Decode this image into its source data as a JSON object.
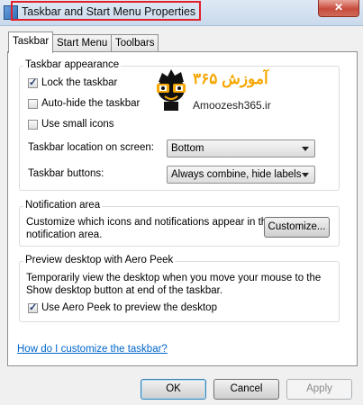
{
  "window": {
    "title": "Taskbar and Start Menu Properties",
    "close_glyph": "✕"
  },
  "tabs": [
    {
      "label": "Taskbar",
      "active": true
    },
    {
      "label": "Start Menu",
      "active": false
    },
    {
      "label": "Toolbars",
      "active": false
    }
  ],
  "appearance": {
    "legend": "Taskbar appearance",
    "lock": {
      "label": "Lock the taskbar",
      "checked": true
    },
    "autohide": {
      "label": "Auto-hide the taskbar",
      "checked": false
    },
    "small_icons": {
      "label": "Use small icons",
      "checked": false
    },
    "location_label": "Taskbar location on screen:",
    "location_value": "Bottom",
    "buttons_label": "Taskbar buttons:",
    "buttons_value": "Always combine, hide labels"
  },
  "watermark": {
    "brand_fa": "آموزش ۳۶۵",
    "url": "Amoozesh365.ir",
    "color": "#f6a600"
  },
  "notification": {
    "legend": "Notification area",
    "description_line1": "Customize which icons and notifications appear in the",
    "description_line2": "notification area.",
    "customize_label": "Customize..."
  },
  "aero_peek": {
    "legend": "Preview desktop with Aero Peek",
    "description_line1": "Temporarily view the desktop when you move your mouse to the",
    "description_line2": "Show desktop button at end of the taskbar.",
    "use_peek": {
      "label": "Use Aero Peek to preview the desktop",
      "checked": true
    }
  },
  "help_link": "How do I customize the taskbar?",
  "footer": {
    "ok": "OK",
    "cancel": "Cancel",
    "apply": "Apply"
  },
  "colors": {
    "highlight_border": "#e2202a",
    "link": "#0066cc"
  }
}
